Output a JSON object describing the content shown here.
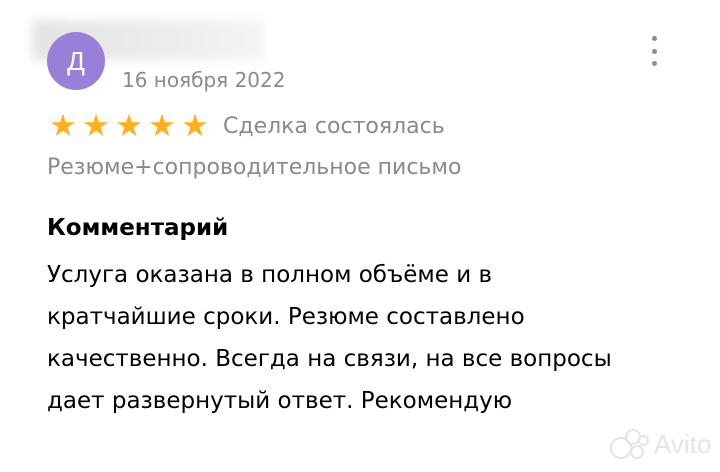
{
  "review": {
    "avatar_letter": "Д",
    "date": "16 ноября 2022",
    "rating": 5,
    "stars": [
      "★",
      "★",
      "★",
      "★",
      "★"
    ],
    "deal_status": "Сделка состоялась",
    "service": "Резюме+сопроводительное письмо",
    "comment_heading": "Комментарий",
    "comment_text": "Услуга оказана в полном объёме и в кратчайшие сроки. Резюме составлено качественно. Всегда на связи, на все вопросы дает развернутый ответ. Рекомендую"
  },
  "menu_icon": "more-vertical-icon",
  "watermark": {
    "text": "Avito",
    "icon": "avito-logo-icon"
  },
  "colors": {
    "avatar_bg": "#9a7fd9",
    "star": "#ffb021",
    "secondary_text": "#8a8a8a"
  }
}
